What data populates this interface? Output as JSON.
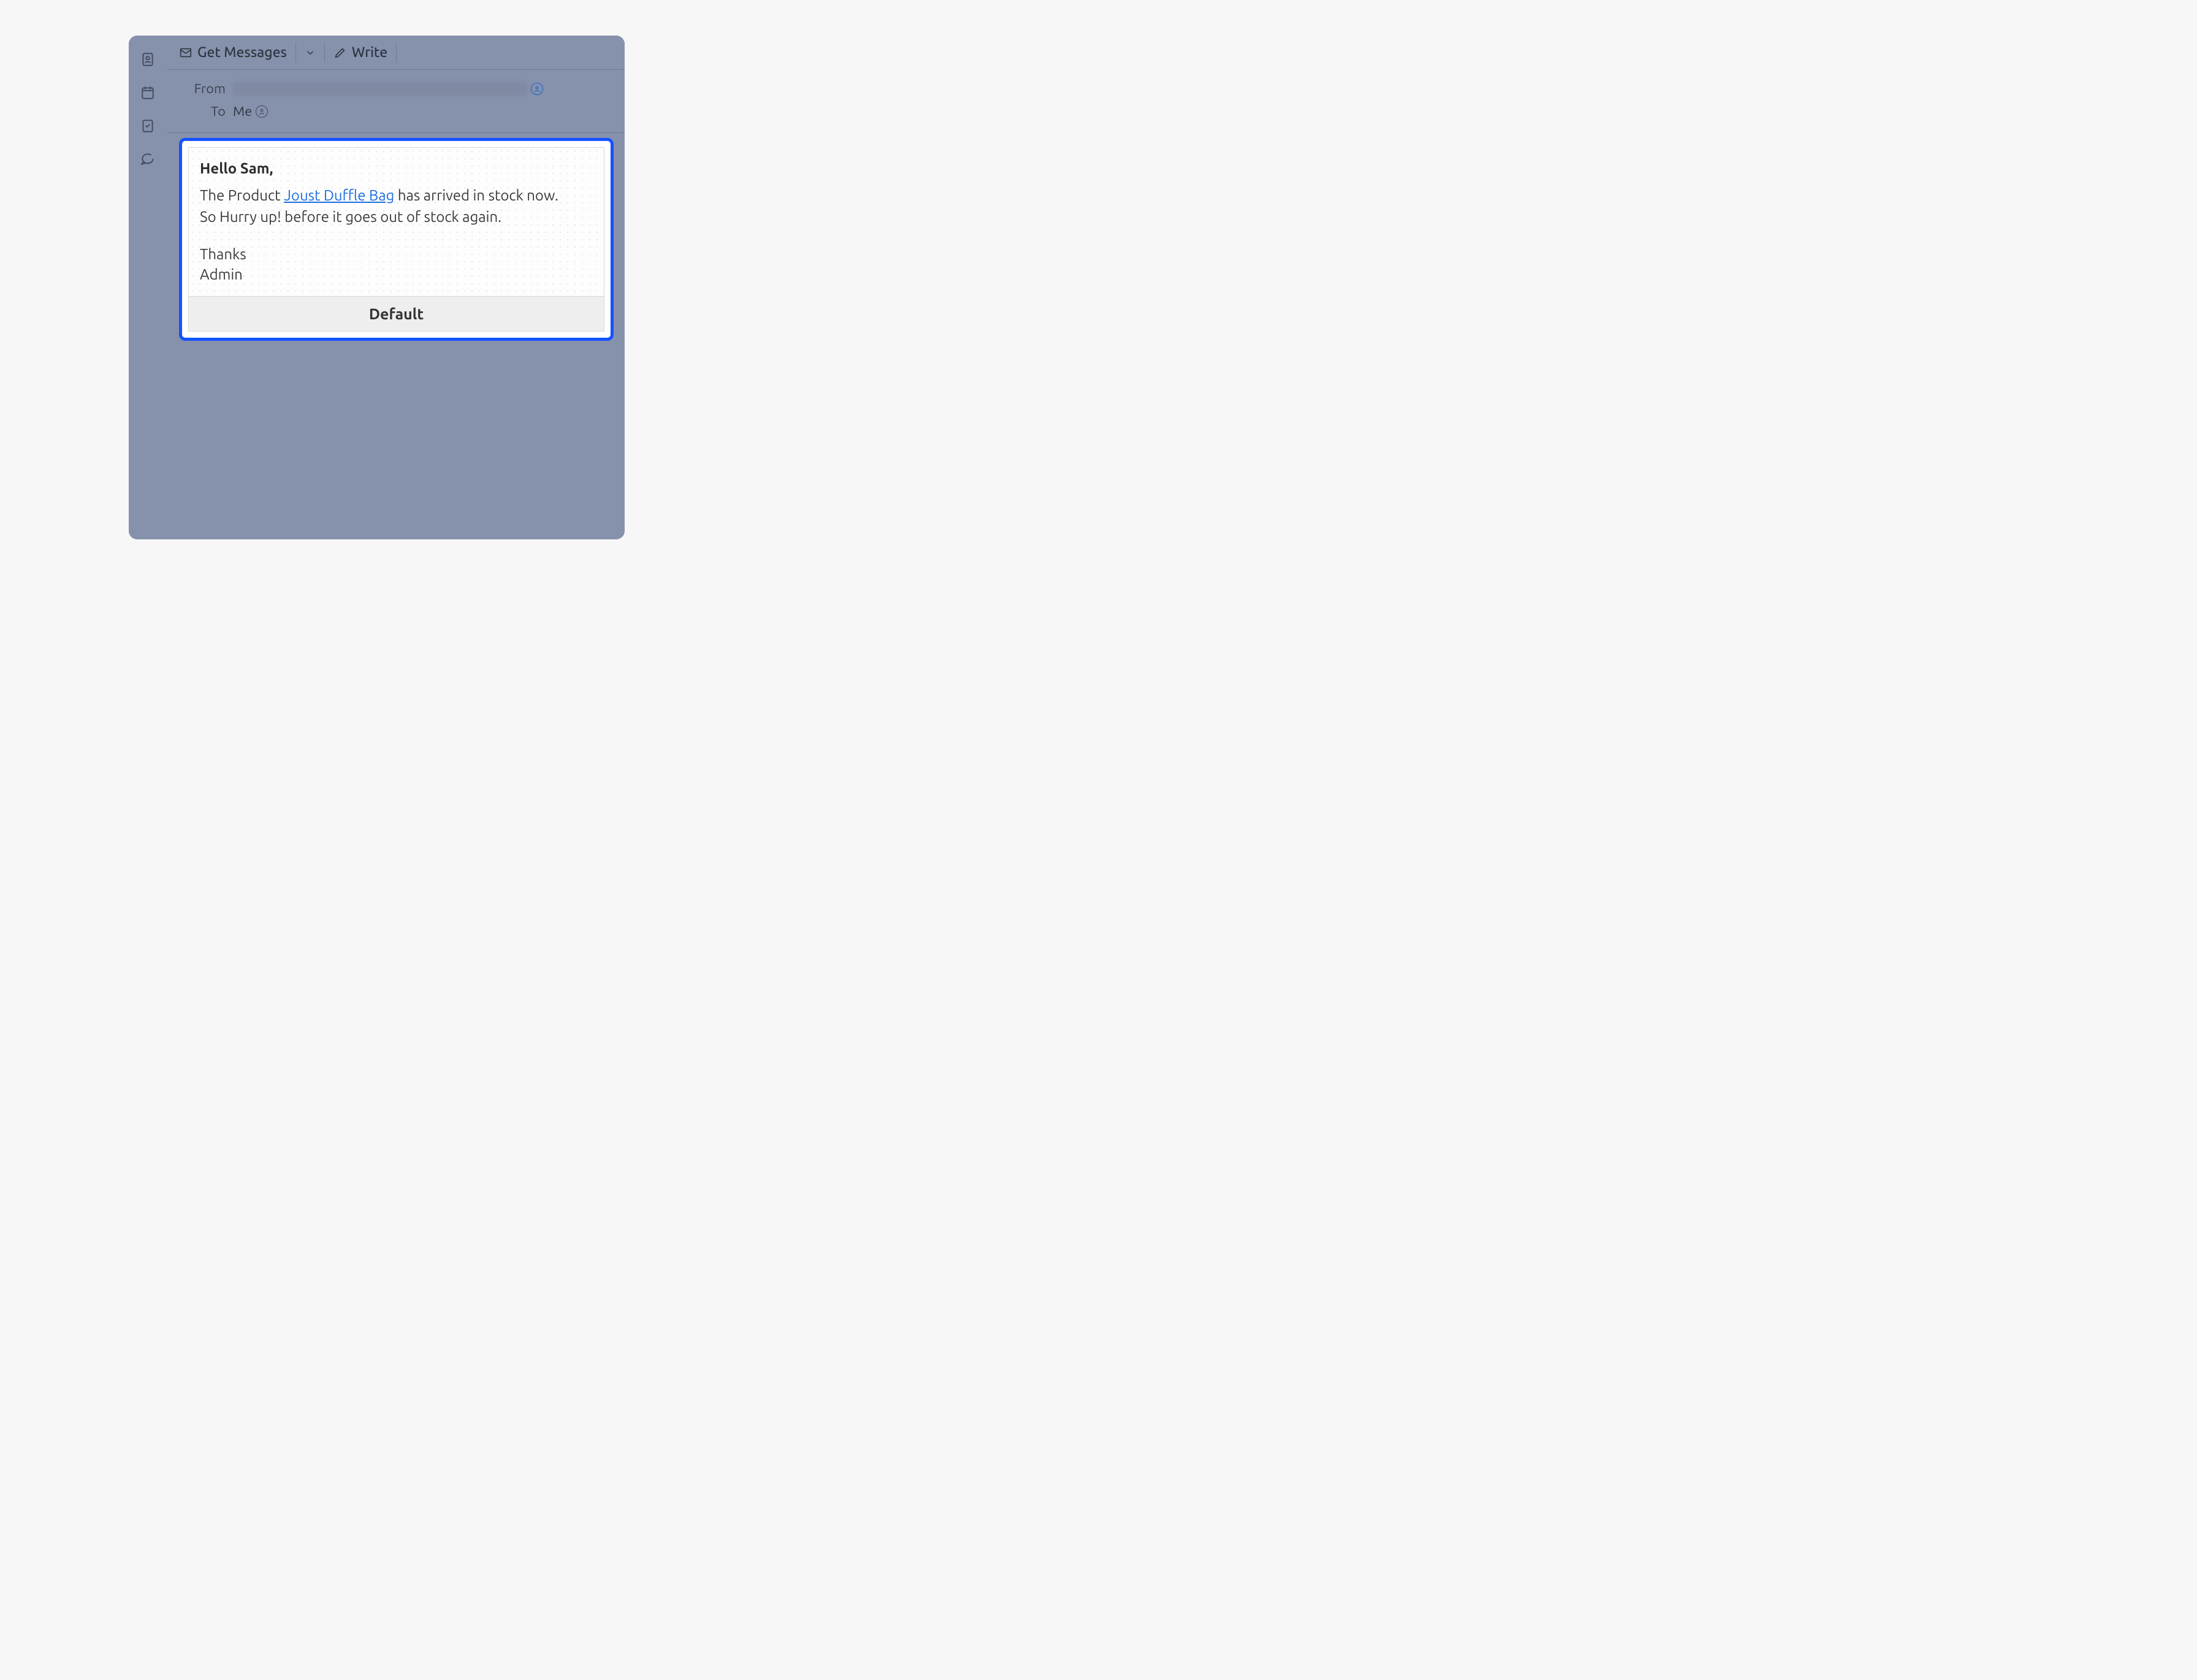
{
  "toolbar": {
    "get_messages_label": "Get Messages",
    "write_label": "Write"
  },
  "headers": {
    "from_label": "From",
    "to_label": "To",
    "to_value": "Me"
  },
  "message": {
    "greeting": "Hello Sam,",
    "line1_before": "The Product ",
    "product_link": "Joust Duffle Bag",
    "line1_after": " has arrived in stock now.",
    "line2": "So Hurry up! before it goes out of stock again.",
    "sign1": "Thanks",
    "sign2": "Admin",
    "footer_label": "Default"
  }
}
